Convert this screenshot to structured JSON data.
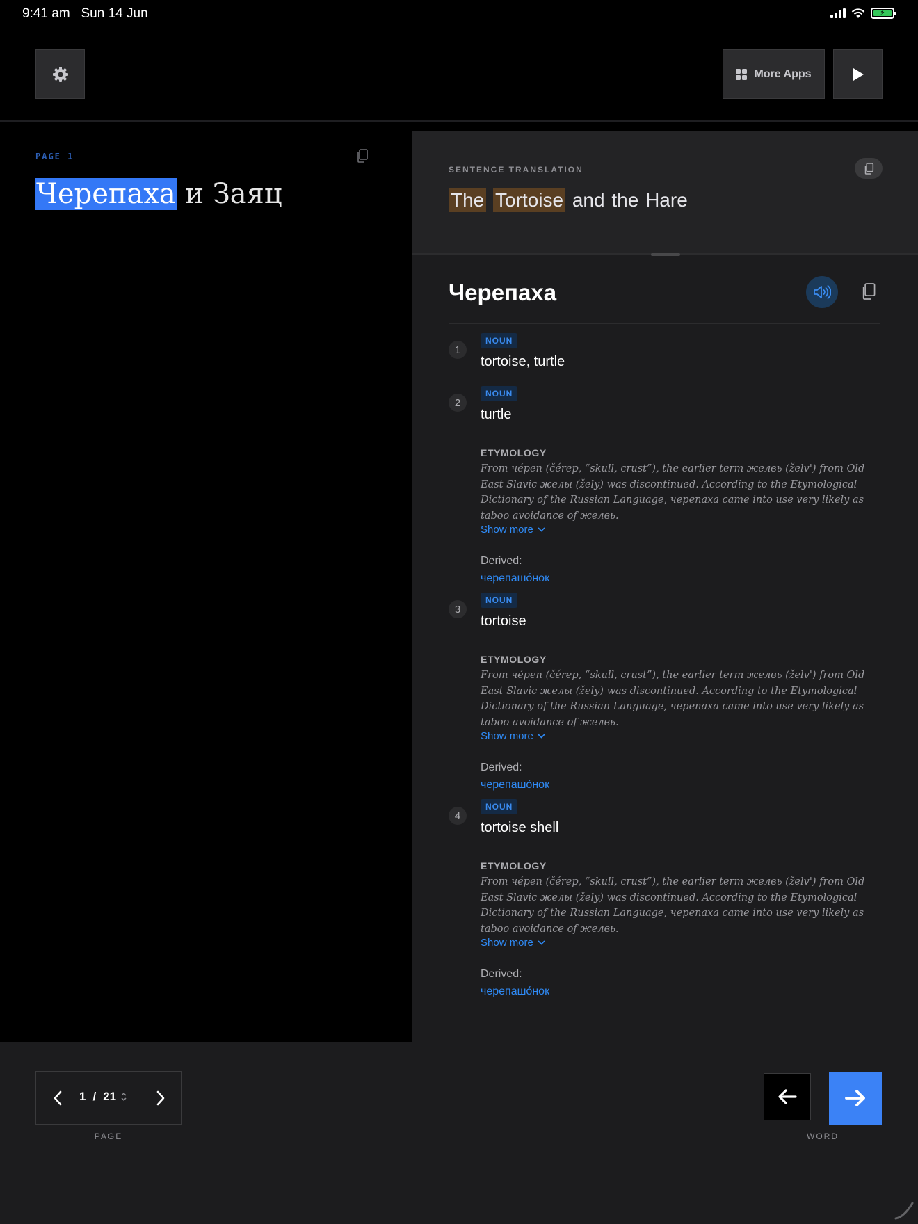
{
  "status_bar": {
    "time": "9:41 am",
    "date": "Sun 14 Jun"
  },
  "toolbar": {
    "more_apps_label": "More Apps"
  },
  "reader": {
    "page_label": "PAGE 1",
    "title_highlighted": "Черепаха",
    "title_rest": " и Заяц"
  },
  "translation": {
    "label": "SENTENCE TRANSLATION",
    "words": [
      "The",
      "Tortoise",
      "and",
      "the",
      "Hare"
    ],
    "highlighted_words": [
      "The",
      "Tortoise"
    ]
  },
  "entry": {
    "headword": "Черепаха",
    "senses": [
      {
        "number": "1",
        "pos": "NOUN",
        "gloss": "tortoise, turtle"
      },
      {
        "number": "2",
        "pos": "NOUN",
        "gloss": "turtle",
        "etymology_label": "ETYMOLOGY",
        "etymology": "From че́реп (čérep, “skull, crust”), the earlier term желвь (želv') from Old East Slavic желы (žely) was discontinued. According to the Etymological Dictionary of the Russian Language, черепаха came into use very likely as taboo avoidance of желвь.",
        "show_more": "Show more",
        "derived_label": "Derived:",
        "derived": "черепашо́нок"
      },
      {
        "number": "3",
        "pos": "NOUN",
        "gloss": "tortoise",
        "etymology_label": "ETYMOLOGY",
        "etymology": "From че́реп (čérep, “skull, crust”), the earlier term желвь (želv') from Old East Slavic желы (žely) was discontinued. According to the Etymological Dictionary of the Russian Language, черепаха came into use very likely as taboo avoidance of желвь.",
        "show_more": "Show more",
        "derived_label": "Derived:",
        "derived": "черепашо́нок"
      },
      {
        "number": "4",
        "pos": "NOUN",
        "gloss": "tortoise shell",
        "etymology_label": "ETYMOLOGY",
        "etymology": "From че́реп (čérep, “skull, crust”), the earlier term желвь (želv') from Old East Slavic желы (žely) was discontinued. According to the Etymological Dictionary of the Russian Language, черепаха came into use very likely as taboo avoidance of желвь.",
        "show_more": "Show more",
        "derived_label": "Derived:",
        "derived": "черепашо́нок"
      }
    ]
  },
  "pager": {
    "current_page": "1",
    "separator": "/",
    "total_pages": "21",
    "caption": "PAGE"
  },
  "word_nav": {
    "caption": "WORD"
  },
  "colors": {
    "accent": "#3b82f6",
    "link": "#2f8af5",
    "highlight_source": "#3478f6",
    "highlight_translation": "#5a3f22",
    "battery": "#34c759"
  },
  "icons": {
    "settings": "gear-icon",
    "more_apps": "grid-icon",
    "play": "play-icon",
    "copy": "copy-icon",
    "speak": "speaker-icon",
    "prev": "chevron-left-icon",
    "next": "chevron-right-icon",
    "stepper": "stepper-icon",
    "word_prev": "arrow-left-icon",
    "word_next": "arrow-right-icon"
  }
}
